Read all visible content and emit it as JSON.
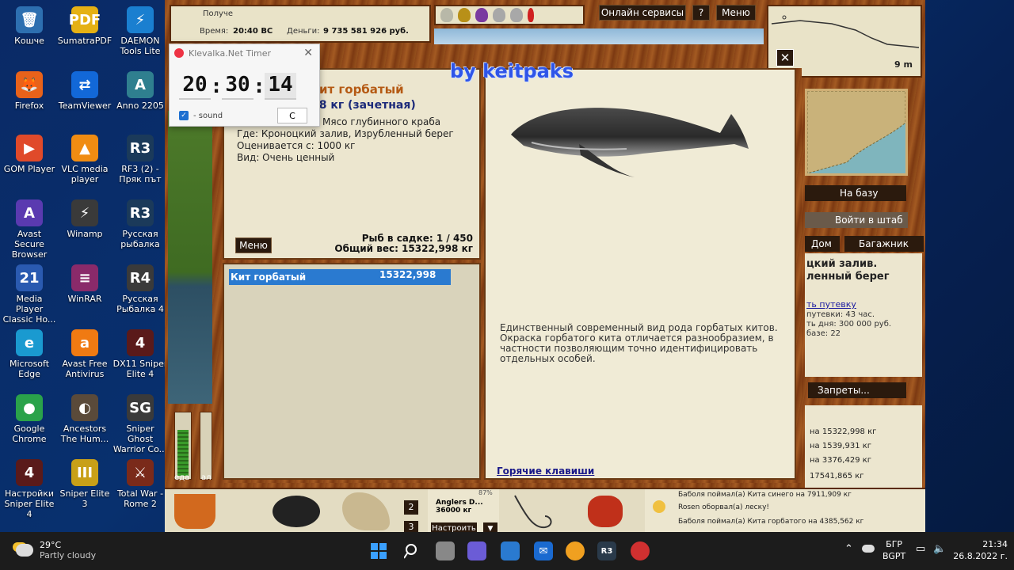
{
  "desktop": {
    "icons": [
      {
        "label": "Кошче",
        "color": "#2d6fb0",
        "glyph": "🗑"
      },
      {
        "label": "SumatraPDF",
        "color": "#e5b114",
        "glyph": "PDF"
      },
      {
        "label": "DAEMON Tools Lite",
        "color": "#1a7fd0",
        "glyph": "⚡"
      },
      {
        "label": "Firefox",
        "color": "#e8621a",
        "glyph": "🦊"
      },
      {
        "label": "TeamViewer",
        "color": "#1268d8",
        "glyph": "⇄"
      },
      {
        "label": "Anno 2205",
        "color": "#2f7f8f",
        "glyph": "A"
      },
      {
        "label": "GOM Player",
        "color": "#e04a2a",
        "glyph": "▶"
      },
      {
        "label": "VLC media player",
        "color": "#f08c12",
        "glyph": "▲"
      },
      {
        "label": "RF3 (2) - Пряк път",
        "color": "#1b3a5a",
        "glyph": "R3"
      },
      {
        "label": "Avast Secure Browser",
        "color": "#5a3ab0",
        "glyph": "A"
      },
      {
        "label": "Winamp",
        "color": "#3a3a3a",
        "glyph": "⚡"
      },
      {
        "label": "Русская рыбалка",
        "color": "#1b3a5a",
        "glyph": "R3"
      },
      {
        "label": "Media Player Classic Ho...",
        "color": "#2a5ab0",
        "glyph": "21"
      },
      {
        "label": "WinRAR",
        "color": "#8a2a6a",
        "glyph": "≡"
      },
      {
        "label": "Русская Рыбалка 4",
        "color": "#3a3a3a",
        "glyph": "R4"
      },
      {
        "label": "Microsoft Edge",
        "color": "#1a9ad0",
        "glyph": "e"
      },
      {
        "label": "Avast Free Antivirus",
        "color": "#f07a12",
        "glyph": "a"
      },
      {
        "label": "DX11 Sniper Elite 4",
        "color": "#5a1a1a",
        "glyph": "4"
      },
      {
        "label": "Google Chrome",
        "color": "#2aa24a",
        "glyph": "●"
      },
      {
        "label": "Ancestors The Hum...",
        "color": "#5a4a3a",
        "glyph": "◐"
      },
      {
        "label": "Sniper Ghost Warrior Co...",
        "color": "#3a3a3a",
        "glyph": "SG"
      },
      {
        "label": "Настройки Sniper Elite 4",
        "color": "#5a1a1a",
        "glyph": "4"
      },
      {
        "label": "Sniper Elite 3",
        "color": "#c8a018",
        "glyph": "III"
      },
      {
        "label": "Total War - Rome 2",
        "color": "#7a2a1a",
        "glyph": "⚔"
      }
    ]
  },
  "game": {
    "top_label": "Получе",
    "time_label": "Время:",
    "time_value": "20:40 ВС",
    "money_label": "Деньги:",
    "money_value": "9 735 581 926 руб.",
    "online_btn": "Онлайн сервисы",
    "help_btn": "?",
    "menu_btn": "Меню",
    "depth": "9 m",
    "base_btn": "На базу",
    "hq_btn": "Войти в штаб",
    "home_btn": "Дом",
    "trunk_btn": "Багажник",
    "location_line1": "цкий залив.",
    "location_line2": "ленный берег",
    "voucher_link": "ть путевку",
    "voucher_line1": "путевки: 43 час.",
    "voucher_line2": "ть дня: 300 000 руб.",
    "voucher_line3": "базе: 22",
    "bans_btn": "Запреты...",
    "log_right": [
      "на 15322,998 кг",
      "на 1539,931 кг",
      "на 3376,429 кг",
      "17541,865 кг"
    ],
    "food_label": "еда",
    "alc_label": "ал",
    "slot2": "2",
    "slot3": "3",
    "anglers_title": "Anglers D...",
    "anglers_weight": "36000 кг",
    "anglers_pct": "87%",
    "configure_btn": "Настроить",
    "chat": [
      "Баболя поймал(а) Кита синего на 7911,909 кг",
      "Rosen оборвал(а) леску!",
      "Баболя поймал(а) Кита горбатого на 4385,562 кг"
    ]
  },
  "dialog": {
    "watermark": "by keitpaks",
    "fish_name": "ит горбатый",
    "fish_weight": "98 кг (зачетная)",
    "bait": "Мясо глубинного краба",
    "where": "Где: Кроноцкий залив, Изрубленный берег",
    "rated": "Оценивается с: 1000 кг",
    "kind": "Вид: Очень ценный",
    "menu_btn": "Меню",
    "fish_in_keepnet": "Рыб в садке: 1 / 450",
    "total_weight": "Общий вес: 15322,998 кг",
    "catch_name": "Кит горбатый",
    "catch_weight": "15322,998",
    "description": "Единственный современный вид рода горбатых китов. Окраска горбатого кита отличается разнообразием, в частности позволяющим точно идентифицировать отдельных особей.",
    "hotkeys": "Горячие клавиши",
    "close": "✕"
  },
  "timer": {
    "title": "Klevalka.Net Timer",
    "hours": "20",
    "minutes": "30",
    "seconds": "14",
    "sound_label": "- sound",
    "c_btn": "C",
    "close": "✕"
  },
  "taskbar": {
    "temp": "29°C",
    "weather": "Partly cloudy",
    "lang1": "БГР",
    "lang2": "BGPT",
    "time": "21:34",
    "date": "26.8.2022 г."
  }
}
